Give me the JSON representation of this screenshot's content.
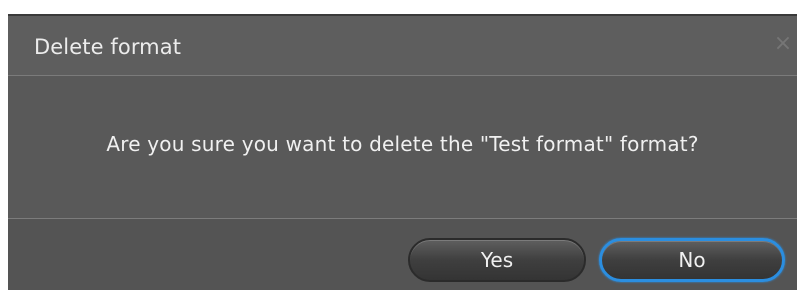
{
  "dialog": {
    "title": "Delete format",
    "close_symbol": "×",
    "close_icon": "close-icon",
    "message": "Are you sure you want to delete the \"Test format\" format?",
    "buttons": {
      "yes_label": "Yes",
      "no_label": "No"
    },
    "focused_button": "No"
  },
  "colors": {
    "dialog_background": "#595959",
    "focus_ring": "#2b8ee0"
  }
}
